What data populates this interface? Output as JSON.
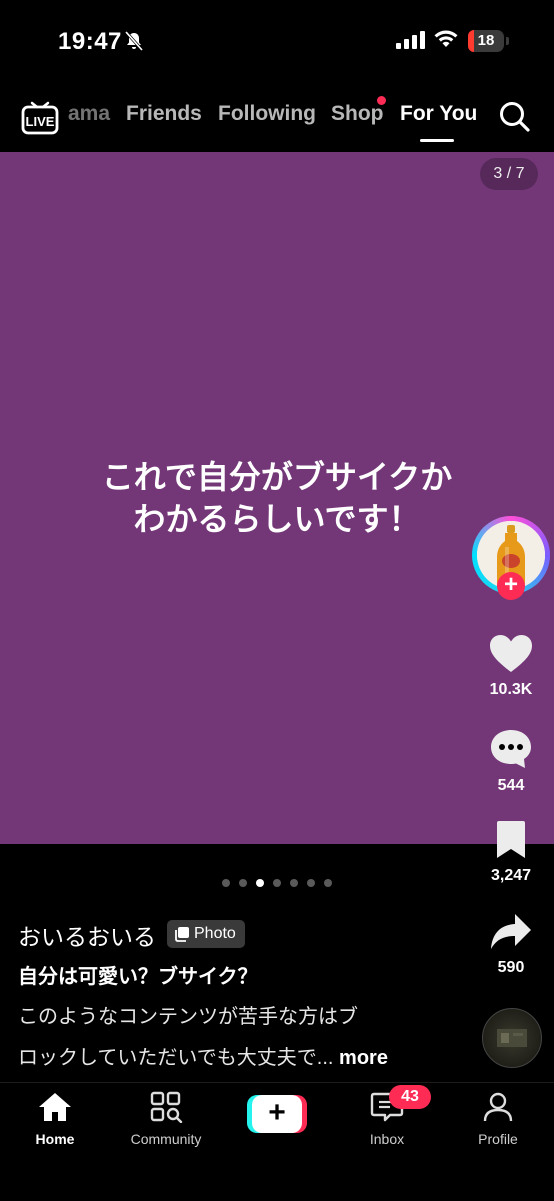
{
  "status_bar": {
    "time": "19:47",
    "battery": "18",
    "battery_level_pct": 18,
    "icons": [
      "bell-slash-icon",
      "cellular-signal-icon",
      "wifi-icon",
      "battery-icon"
    ]
  },
  "top_nav": {
    "live_label": "LIVE",
    "tabs": [
      "ama",
      "Friends",
      "Following",
      "Shop",
      "For You"
    ],
    "active_tab": "For You",
    "search_icon": "search-icon"
  },
  "post": {
    "slide_counter": "3 / 7",
    "slide_current": 3,
    "slide_total": 7,
    "headline_line1": "これで自分がブサイクか",
    "headline_line2": "わかるらしいです！",
    "background_color": "#733778",
    "author": "おいるおいる",
    "badge": "Photo",
    "title": "自分は可愛い？ブサイク？",
    "description_line1": "このようなコンテンツが苦手な方はブ",
    "description_line2": "ロックしていただいでも大丈夫で...",
    "more_label": "more",
    "carousel_dots": 7,
    "carousel_active_index": 2
  },
  "actions": {
    "likes": "10.3K",
    "comments": "544",
    "bookmarks": "3,247",
    "shares": "590"
  },
  "bottom_nav": {
    "items": [
      {
        "label": "Home",
        "icon": "home-icon"
      },
      {
        "label": "Community",
        "icon": "community-icon"
      },
      {
        "label": "",
        "icon": "create-plus-icon"
      },
      {
        "label": "Inbox",
        "icon": "inbox-icon"
      },
      {
        "label": "Profile",
        "icon": "profile-icon"
      }
    ],
    "inbox_badge": "43"
  },
  "colors": {
    "accent": "#fe2c55",
    "cyan": "#25f4ee",
    "background": "#000000"
  }
}
